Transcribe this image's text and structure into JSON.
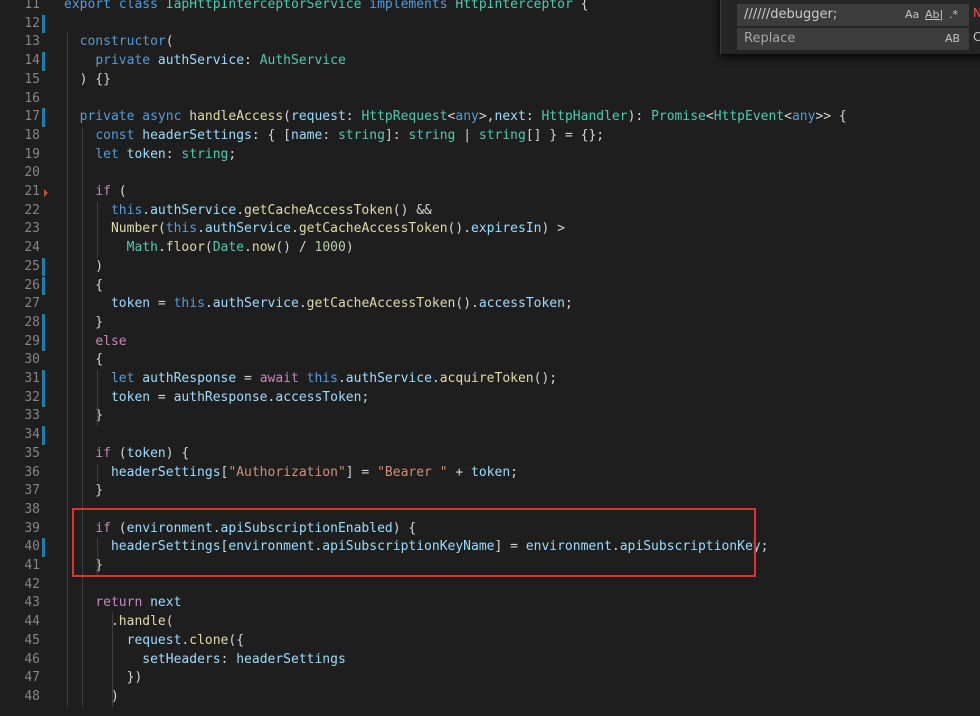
{
  "editor": {
    "lines": [
      {
        "n": "11",
        "mark": false,
        "tokens": [
          [
            "kw",
            "export"
          ],
          [
            "",
            "_"
          ],
          [
            "kw",
            "class"
          ],
          [
            "",
            "_"
          ],
          [
            "ty",
            "IapHttpInterceptorService"
          ],
          [
            "",
            "_"
          ],
          [
            "kw",
            "implements"
          ],
          [
            "",
            "_"
          ],
          [
            "ty",
            "HttpInterceptor"
          ],
          [
            "",
            " {"
          ]
        ]
      },
      {
        "n": "12",
        "mark": true,
        "tokens": []
      },
      {
        "n": "13",
        "mark": false,
        "tokens": [
          [
            "",
            "  "
          ],
          [
            "kw",
            "constructor"
          ],
          [
            "",
            "("
          ]
        ]
      },
      {
        "n": "14",
        "mark": true,
        "tokens": [
          [
            "",
            "    "
          ],
          [
            "kw",
            "private"
          ],
          [
            "",
            ""
          ],
          [
            "va",
            " authService"
          ],
          [
            "",
            ": "
          ],
          [
            "ty",
            "AuthService"
          ]
        ]
      },
      {
        "n": "15",
        "mark": false,
        "tokens": [
          [
            "",
            "  ) {}"
          ]
        ]
      },
      {
        "n": "16",
        "mark": false,
        "tokens": []
      },
      {
        "n": "17",
        "mark": true,
        "tokens": [
          [
            "",
            "  "
          ],
          [
            "kw",
            "private"
          ],
          [
            "",
            " "
          ],
          [
            "kw",
            "async"
          ],
          [
            "",
            " "
          ],
          [
            "fn",
            "handleAccess"
          ],
          [
            "",
            "("
          ],
          [
            "va",
            "request"
          ],
          [
            "",
            ": "
          ],
          [
            "ty",
            "HttpRequest"
          ],
          [
            "",
            "<"
          ],
          [
            "kw",
            "any"
          ],
          [
            "",
            ">,"
          ],
          [
            "va",
            "next"
          ],
          [
            "",
            ": "
          ],
          [
            "ty",
            "HttpHandler"
          ],
          [
            "",
            "): "
          ],
          [
            "ty",
            "Promise"
          ],
          [
            "",
            "<"
          ],
          [
            "ty",
            "HttpEvent"
          ],
          [
            "",
            "<"
          ],
          [
            "kw",
            "any"
          ],
          [
            "",
            ">> {"
          ]
        ]
      },
      {
        "n": "18",
        "mark": false,
        "tokens": [
          [
            "",
            "    "
          ],
          [
            "kw",
            "const"
          ],
          [
            "",
            " "
          ],
          [
            "va",
            "headerSettings"
          ],
          [
            "",
            ": { ["
          ],
          [
            "va",
            "name"
          ],
          [
            "",
            ": "
          ],
          [
            "ty",
            "string"
          ],
          [
            "",
            "]: "
          ],
          [
            "ty",
            "string"
          ],
          [
            "",
            " | "
          ],
          [
            "ty",
            "string"
          ],
          [
            "",
            "[] } = {};"
          ]
        ]
      },
      {
        "n": "19",
        "mark": false,
        "tokens": [
          [
            "",
            "    "
          ],
          [
            "kw",
            "let"
          ],
          [
            "",
            " "
          ],
          [
            "va",
            "token"
          ],
          [
            "",
            ": "
          ],
          [
            "ty",
            "string"
          ],
          [
            "",
            ";"
          ]
        ]
      },
      {
        "n": "20",
        "mark": false,
        "tokens": []
      },
      {
        "n": "21",
        "mark": false,
        "arrow": true,
        "tokens": [
          [
            "",
            "    "
          ],
          [
            "cf",
            "if"
          ],
          [
            "",
            " ("
          ]
        ]
      },
      {
        "n": "22",
        "mark": false,
        "tokens": [
          [
            "",
            "      "
          ],
          [
            "kw",
            "this"
          ],
          [
            "",
            "."
          ],
          [
            "va",
            "authService"
          ],
          [
            "",
            "."
          ],
          [
            "fn",
            "getCacheAccessToken"
          ],
          [
            "",
            "() &&"
          ]
        ]
      },
      {
        "n": "23",
        "mark": false,
        "tokens": [
          [
            "",
            "      "
          ],
          [
            "fn",
            "Number"
          ],
          [
            "",
            "("
          ],
          [
            "kw",
            "this"
          ],
          [
            "",
            "."
          ],
          [
            "va",
            "authService"
          ],
          [
            "",
            "."
          ],
          [
            "fn",
            "getCacheAccessToken"
          ],
          [
            "",
            "()."
          ],
          [
            "va",
            "expiresIn"
          ],
          [
            "",
            ") >"
          ]
        ]
      },
      {
        "n": "24",
        "mark": false,
        "tokens": [
          [
            "",
            "        "
          ],
          [
            "ty",
            "Math"
          ],
          [
            "",
            "."
          ],
          [
            "fn",
            "floor"
          ],
          [
            "",
            "("
          ],
          [
            "ty",
            "Date"
          ],
          [
            "",
            "."
          ],
          [
            "fn",
            "now"
          ],
          [
            "",
            "() / "
          ],
          [
            "nu",
            "1000"
          ],
          [
            "",
            ")"
          ]
        ]
      },
      {
        "n": "25",
        "mark": true,
        "tokens": [
          [
            "",
            "    )"
          ]
        ]
      },
      {
        "n": "26",
        "mark": true,
        "tokens": [
          [
            "",
            "    {"
          ]
        ]
      },
      {
        "n": "27",
        "mark": false,
        "tokens": [
          [
            "",
            "      "
          ],
          [
            "va",
            "token"
          ],
          [
            "",
            " = "
          ],
          [
            "kw",
            "this"
          ],
          [
            "",
            "."
          ],
          [
            "va",
            "authService"
          ],
          [
            "",
            "."
          ],
          [
            "fn",
            "getCacheAccessToken"
          ],
          [
            "",
            "()."
          ],
          [
            "va",
            "accessToken"
          ],
          [
            "",
            ";"
          ]
        ]
      },
      {
        "n": "28",
        "mark": true,
        "tokens": [
          [
            "",
            "    }"
          ]
        ]
      },
      {
        "n": "29",
        "mark": true,
        "tokens": [
          [
            "",
            "    "
          ],
          [
            "cf",
            "else"
          ]
        ]
      },
      {
        "n": "30",
        "mark": false,
        "tokens": [
          [
            "",
            "    {"
          ]
        ]
      },
      {
        "n": "31",
        "mark": true,
        "tokens": [
          [
            "",
            "      "
          ],
          [
            "kw",
            "let"
          ],
          [
            "",
            " "
          ],
          [
            "va",
            "authResponse"
          ],
          [
            "",
            " = "
          ],
          [
            "cf",
            "await"
          ],
          [
            "",
            " "
          ],
          [
            "kw",
            "this"
          ],
          [
            "",
            "."
          ],
          [
            "va",
            "authService"
          ],
          [
            "",
            "."
          ],
          [
            "fn",
            "acquireToken"
          ],
          [
            "",
            "();"
          ]
        ]
      },
      {
        "n": "32",
        "mark": true,
        "tokens": [
          [
            "",
            "      "
          ],
          [
            "va",
            "token"
          ],
          [
            "",
            " = "
          ],
          [
            "va",
            "authResponse"
          ],
          [
            "",
            "."
          ],
          [
            "va",
            "accessToken"
          ],
          [
            "",
            ";"
          ]
        ]
      },
      {
        "n": "33",
        "mark": false,
        "tokens": [
          [
            "",
            "    }"
          ]
        ]
      },
      {
        "n": "34",
        "mark": true,
        "tokens": []
      },
      {
        "n": "35",
        "mark": false,
        "tokens": [
          [
            "",
            "    "
          ],
          [
            "cf",
            "if"
          ],
          [
            "",
            " ("
          ],
          [
            "va",
            "token"
          ],
          [
            "",
            ") {"
          ]
        ]
      },
      {
        "n": "36",
        "mark": false,
        "tokens": [
          [
            "",
            "      "
          ],
          [
            "va",
            "headerSettings"
          ],
          [
            "",
            "["
          ],
          [
            "st",
            "\"Authorization\""
          ],
          [
            "",
            "] = "
          ],
          [
            "st",
            "\"Bearer \""
          ],
          [
            "",
            " + "
          ],
          [
            "va",
            "token"
          ],
          [
            "",
            ";"
          ]
        ]
      },
      {
        "n": "37",
        "mark": false,
        "tokens": [
          [
            "",
            "    }"
          ]
        ]
      },
      {
        "n": "38",
        "mark": false,
        "tokens": []
      },
      {
        "n": "39",
        "mark": false,
        "tokens": [
          [
            "",
            "    "
          ],
          [
            "cf",
            "if"
          ],
          [
            "",
            " ("
          ],
          [
            "va",
            "environment"
          ],
          [
            "",
            "."
          ],
          [
            "va",
            "apiSubscriptionEnabled"
          ],
          [
            "",
            ") {"
          ]
        ]
      },
      {
        "n": "40",
        "mark": true,
        "tokens": [
          [
            "",
            "      "
          ],
          [
            "va",
            "headerSettings"
          ],
          [
            "",
            "["
          ],
          [
            "va",
            "environment"
          ],
          [
            "",
            "."
          ],
          [
            "va",
            "apiSubscriptionKeyName"
          ],
          [
            "",
            "] = "
          ],
          [
            "va",
            "environment"
          ],
          [
            "",
            "."
          ],
          [
            "va",
            "apiSubscriptionKey"
          ],
          [
            "",
            ";"
          ]
        ]
      },
      {
        "n": "41",
        "mark": false,
        "tokens": [
          [
            "",
            "    }"
          ]
        ]
      },
      {
        "n": "42",
        "mark": false,
        "tokens": []
      },
      {
        "n": "43",
        "mark": false,
        "tokens": [
          [
            "",
            "    "
          ],
          [
            "cf",
            "return"
          ],
          [
            "",
            " "
          ],
          [
            "va",
            "next"
          ]
        ]
      },
      {
        "n": "44",
        "mark": false,
        "tokens": [
          [
            "",
            "      ."
          ],
          [
            "fn",
            "handle"
          ],
          [
            "",
            "("
          ]
        ]
      },
      {
        "n": "45",
        "mark": false,
        "tokens": [
          [
            "",
            "        "
          ],
          [
            "va",
            "request"
          ],
          [
            "",
            "."
          ],
          [
            "fn",
            "clone"
          ],
          [
            "",
            "({"
          ]
        ]
      },
      {
        "n": "46",
        "mark": false,
        "tokens": [
          [
            "",
            "          "
          ],
          [
            "va",
            "setHeaders"
          ],
          [
            "",
            ": "
          ],
          [
            "va",
            "headerSettings"
          ]
        ]
      },
      {
        "n": "47",
        "mark": false,
        "tokens": [
          [
            "",
            "        })"
          ]
        ]
      },
      {
        "n": "48",
        "mark": false,
        "tokens": [
          [
            "",
            "      )"
          ]
        ]
      }
    ]
  },
  "find_widget": {
    "find_value": "//////debugger;",
    "replace_placeholder": "Replace",
    "match_case_label": "Aa",
    "whole_word_label": "Ab|",
    "regex_label": ".*",
    "preserve_case_label": "AB",
    "extra_label_find": "N",
    "extra_label_replace": "C"
  },
  "colors": {
    "background": "#1e1e1e",
    "highlight_border": "#e0312d",
    "change_marker": "#1b81a8"
  }
}
